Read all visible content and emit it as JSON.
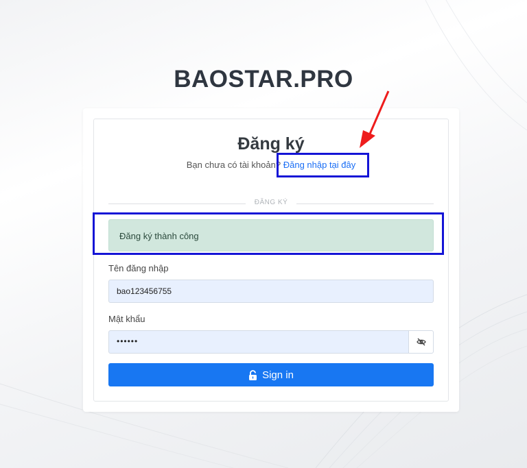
{
  "brand": {
    "name": "BAOSTAR.PRO"
  },
  "form": {
    "title": "Đăng ký",
    "subtitle_prefix": "Bạn chưa có tài khoản?",
    "login_link": "Đăng nhập tại đây",
    "divider_label": "ĐĂNG KÝ",
    "alert_message": "Đăng ký thành công",
    "username_label": "Tên đăng nhập",
    "username_value": "bao123456755",
    "password_label": "Mật khẩu",
    "password_value": "••••••",
    "signin_label": "Sign in"
  },
  "icons": {
    "lock": "lock-open-icon",
    "toggle": "eye-slash-icon"
  },
  "colors": {
    "primary": "#1877f2",
    "alert_bg": "#d1e7dd",
    "input_bg": "#e8f0fe",
    "highlight": "#1414d6",
    "arrow": "#ee1c1c"
  }
}
